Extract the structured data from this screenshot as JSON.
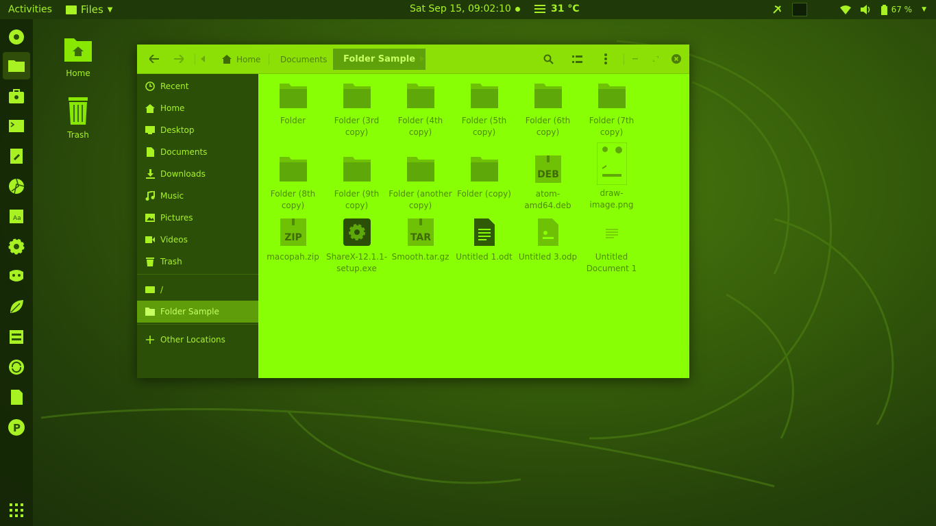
{
  "topbar": {
    "activities": "Activities",
    "app_menu": "Files",
    "clock": "Sat Sep 15, 09:02:10",
    "temperature": "31 °C",
    "battery": "67 %"
  },
  "dock": {
    "items": [
      "disk-icon",
      "files-icon",
      "store-icon",
      "terminal-icon",
      "editor-icon",
      "aperture-icon",
      "font-viewer-icon",
      "settings-icon",
      "gimp-icon",
      "leaf-icon",
      "storage-icon",
      "sync-icon",
      "document-icon",
      "p-app-icon"
    ]
  },
  "desktop": {
    "icons": [
      {
        "label": "Home"
      },
      {
        "label": "Trash"
      }
    ]
  },
  "window": {
    "breadcrumbs": [
      {
        "label": "Home"
      },
      {
        "label": "Documents"
      },
      {
        "label": "Folder Sample"
      }
    ],
    "sidebar": {
      "items": [
        {
          "label": "Recent",
          "icon": "clock-icon"
        },
        {
          "label": "Home",
          "icon": "home-icon"
        },
        {
          "label": "Desktop",
          "icon": "desktop-icon"
        },
        {
          "label": "Documents",
          "icon": "document-icon"
        },
        {
          "label": "Downloads",
          "icon": "download-icon"
        },
        {
          "label": "Music",
          "icon": "music-icon"
        },
        {
          "label": "Pictures",
          "icon": "picture-icon"
        },
        {
          "label": "Videos",
          "icon": "video-icon"
        },
        {
          "label": "Trash",
          "icon": "trash-icon"
        }
      ],
      "devices": [
        {
          "label": "/",
          "icon": "drive-icon"
        },
        {
          "label": "Folder Sample",
          "icon": "folder-icon"
        }
      ],
      "other": {
        "label": "Other Locations",
        "icon": "plus-icon"
      }
    },
    "files": [
      {
        "name": "Folder",
        "type": "folder"
      },
      {
        "name": "Folder (3rd copy)",
        "type": "folder"
      },
      {
        "name": "Folder (4th copy)",
        "type": "folder"
      },
      {
        "name": "Folder (5th copy)",
        "type": "folder"
      },
      {
        "name": "Folder (6th copy)",
        "type": "folder"
      },
      {
        "name": "Folder (7th copy)",
        "type": "folder"
      },
      {
        "name": "Folder (8th copy)",
        "type": "folder"
      },
      {
        "name": "Folder (9th copy)",
        "type": "folder"
      },
      {
        "name": "Folder (another copy)",
        "type": "folder"
      },
      {
        "name": "Folder (copy)",
        "type": "folder"
      },
      {
        "name": "atom-amd64.deb",
        "type": "archive",
        "badge": "DEB"
      },
      {
        "name": "draw-image.png",
        "type": "image"
      },
      {
        "name": "macopah.zip",
        "type": "archive",
        "badge": "ZIP"
      },
      {
        "name": "ShareX-12.1.1-setup.exe",
        "type": "exe"
      },
      {
        "name": "Smooth.tar.gz",
        "type": "archive",
        "badge": "TAR"
      },
      {
        "name": "Untitled 1.odt",
        "type": "doc"
      },
      {
        "name": "Untitled 3.odp",
        "type": "presentation"
      },
      {
        "name": "Untitled Document 1",
        "type": "text"
      }
    ]
  }
}
